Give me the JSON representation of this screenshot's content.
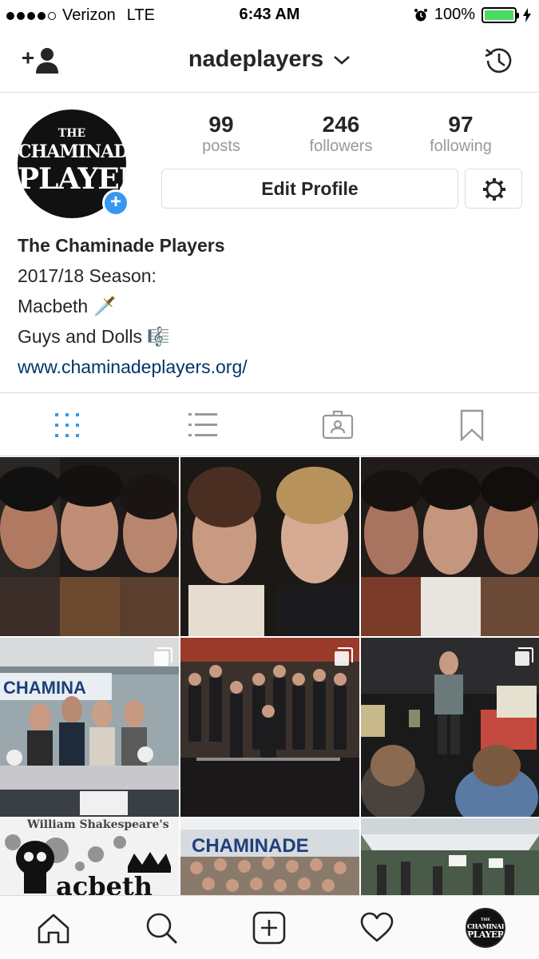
{
  "status_bar": {
    "carrier": "Verizon",
    "network": "LTE",
    "time": "6:43 AM",
    "battery_percent": "100%",
    "battery_color": "#4cd964"
  },
  "header": {
    "username": "nadeplayers",
    "username_chevron": "chevron-down-icon",
    "left_icon": "add-user-icon",
    "right_icon": "history-icon"
  },
  "profile": {
    "avatar_lines": [
      "THE",
      "CHAMINADE",
      "PLAYERS"
    ],
    "stats": [
      {
        "value": "99",
        "label": "posts"
      },
      {
        "value": "246",
        "label": "followers"
      },
      {
        "value": "97",
        "label": "following"
      }
    ],
    "edit_label": "Edit Profile",
    "settings_icon": "gear-icon",
    "name": "The Chaminade Players",
    "bio_lines": [
      "2017/18 Season:",
      "Macbeth 🗡️",
      "Guys and Dolls 🎼"
    ],
    "website": "www.chaminadeplayers.org/"
  },
  "view_tabs": [
    {
      "icon": "grid-icon",
      "active": true
    },
    {
      "icon": "list-icon",
      "active": false
    },
    {
      "icon": "tagged-icon",
      "active": false
    },
    {
      "icon": "saved-icon",
      "active": false
    }
  ],
  "grid_posts": [
    {
      "subject": "three cast portraits",
      "multi": false
    },
    {
      "subject": "two cast portraits",
      "multi": false
    },
    {
      "subject": "three cast portraits",
      "multi": false
    },
    {
      "subject": "club fair booth",
      "multi": true,
      "booth_sign": "CHAMINA"
    },
    {
      "subject": "group on stage",
      "multi": true
    },
    {
      "subject": "rehearsal",
      "multi": true
    },
    {
      "subject": "macbeth poster",
      "multi": false,
      "poster_text": "William Shakespeare's",
      "poster_title": "acbeth"
    },
    {
      "subject": "booth group photo",
      "multi": false,
      "banner": "CHAMINADE"
    },
    {
      "subject": "outdoor event",
      "multi": false
    }
  ],
  "tab_bar": [
    {
      "icon": "home-icon"
    },
    {
      "icon": "search-icon"
    },
    {
      "icon": "add-post-icon"
    },
    {
      "icon": "heart-icon"
    },
    {
      "icon": "profile-avatar-icon"
    }
  ],
  "colors": {
    "link": "#003569",
    "active_tab": "#3897f0",
    "border": "#dbdbdb",
    "muted": "#999999"
  }
}
